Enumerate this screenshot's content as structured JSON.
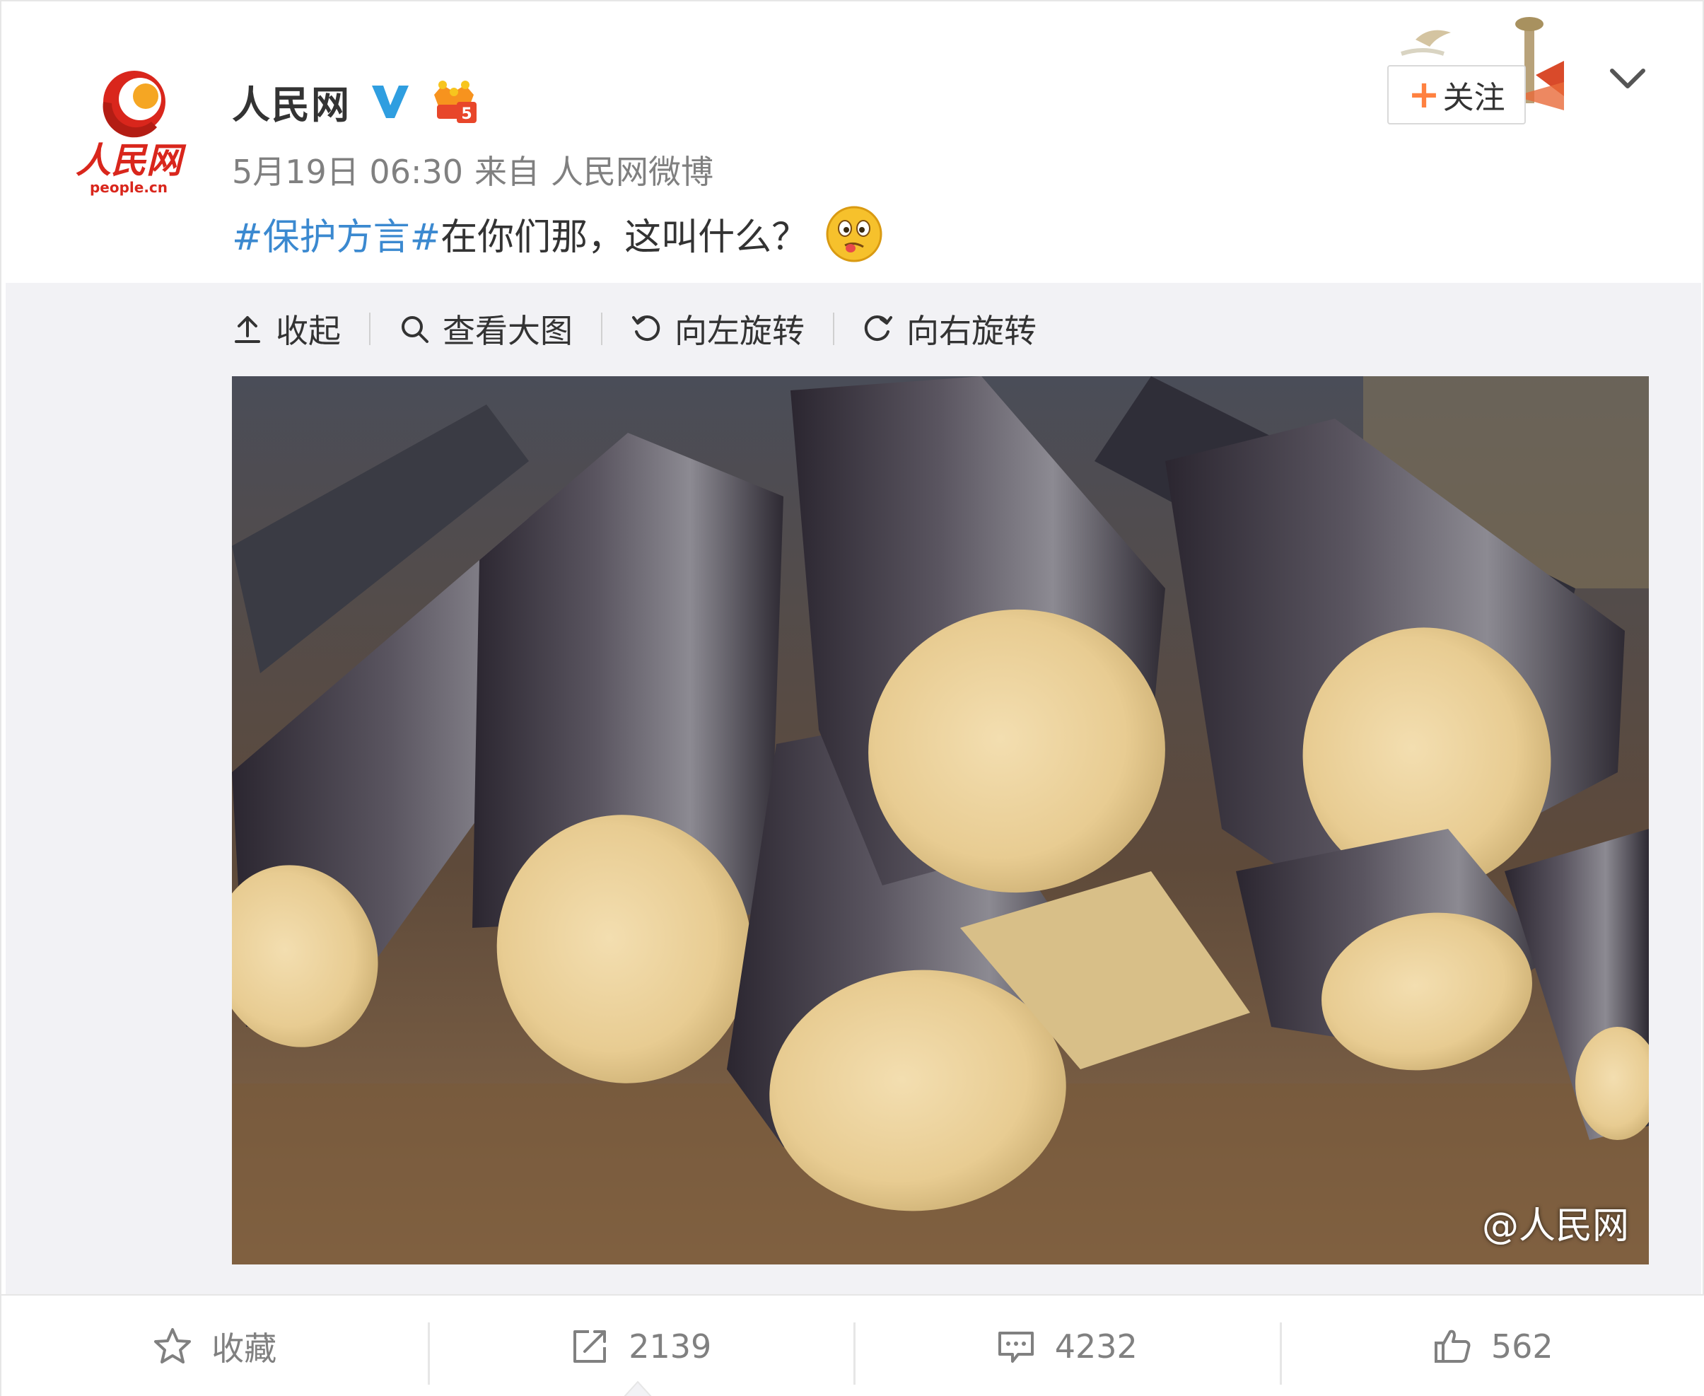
{
  "post": {
    "author": "人民网",
    "date": "5月19日 06:30",
    "source_prefix": "来自",
    "source": "人民网微博",
    "topic": "#保护方言#",
    "text": "在你们那，这叫什么？",
    "logo_text": "人民网",
    "logo_subtext": "people.cn"
  },
  "header": {
    "follow_label": "关注",
    "follow_plus": "+"
  },
  "media_toolbar": {
    "collapse": "收起",
    "view_large": "查看大图",
    "rotate_left": "向左旋转",
    "rotate_right": "向右旋转"
  },
  "image": {
    "watermark": "@人民网"
  },
  "actions": {
    "favorite_label": "收藏",
    "repost_count": "2139",
    "comment_count": "4232",
    "like_count": "562"
  },
  "colors": {
    "topic_link": "#3b89d0",
    "follow_plus": "#ff8140",
    "muted_text": "#808080",
    "brand_red": "#d9261c"
  },
  "icons": [
    "verified-icon",
    "member-badge-icon",
    "emoji-icon",
    "chevron-down-icon",
    "collapse-icon",
    "search-icon",
    "rotate-left-icon",
    "rotate-right-icon",
    "star-icon",
    "repost-icon",
    "comment-icon",
    "like-icon"
  ]
}
